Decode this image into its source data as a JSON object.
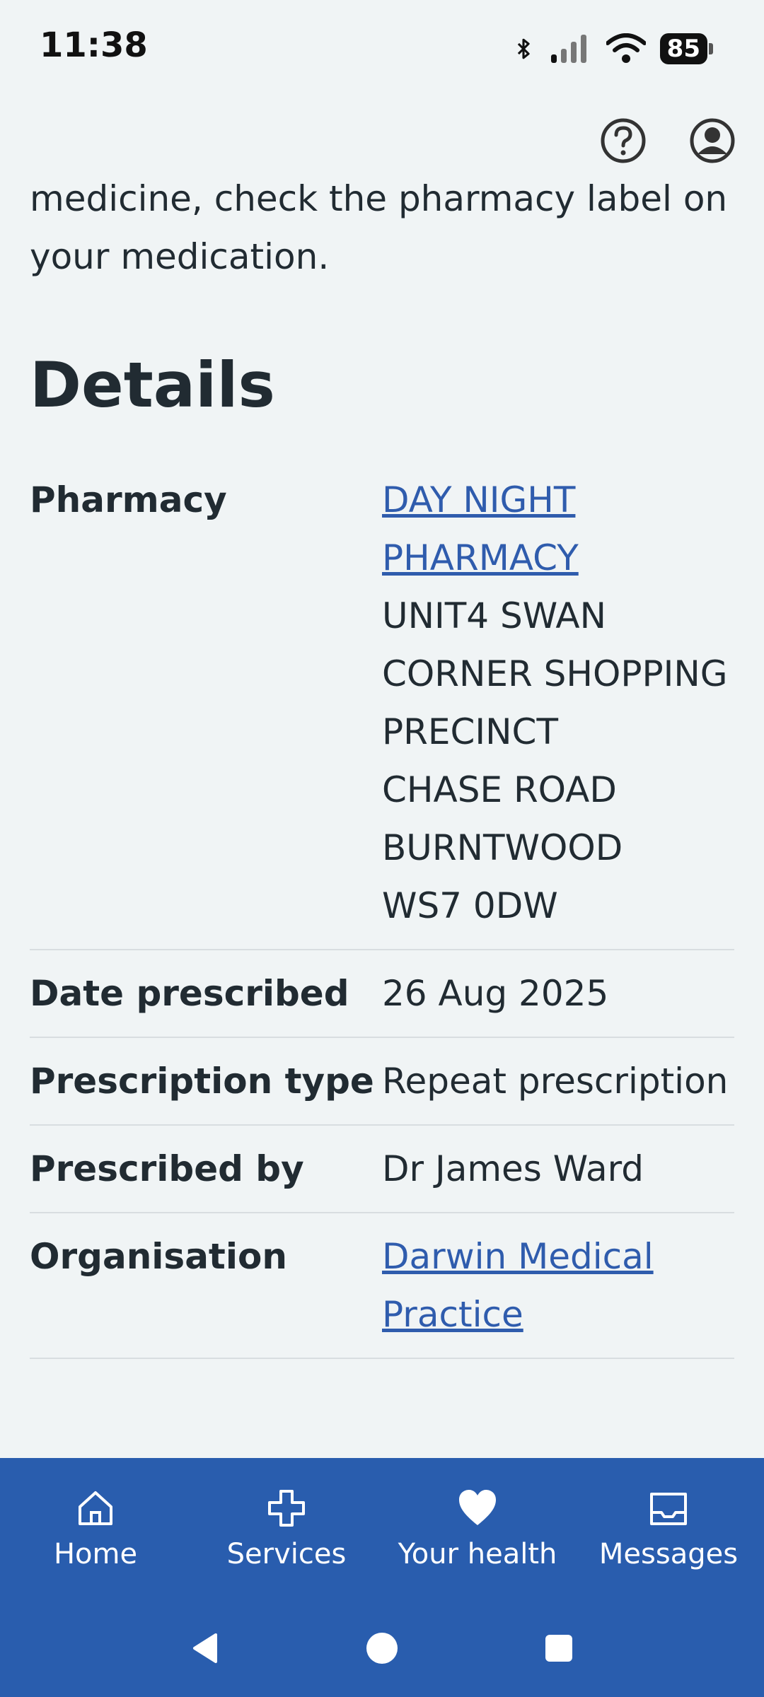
{
  "status": {
    "time": "11:38",
    "battery": "85"
  },
  "intro_text": "medicine, check the pharmacy label on your medication.",
  "details": {
    "heading": "Details",
    "rows": [
      {
        "key": "Pharmacy",
        "link": "DAY NIGHT PHARMACY",
        "lines": [
          "UNIT4 SWAN",
          "CORNER SHOPPING",
          "PRECINCT",
          "CHASE ROAD",
          "BURNTWOOD",
          "WS7 0DW"
        ]
      },
      {
        "key": "Date prescribed",
        "value": "26 Aug 2025"
      },
      {
        "key": "Prescription type",
        "value": "Repeat prescription"
      },
      {
        "key": "Prescribed by",
        "value": "Dr James Ward"
      },
      {
        "key": "Organisation",
        "link": "Darwin Medical Practice"
      }
    ]
  },
  "nav": {
    "home": "Home",
    "services": "Services",
    "your_health": "Your health",
    "messages": "Messages"
  },
  "colors": {
    "accent": "#295dae",
    "link": "#2f5cad",
    "background": "#f0f4f5",
    "text": "#212b32"
  }
}
